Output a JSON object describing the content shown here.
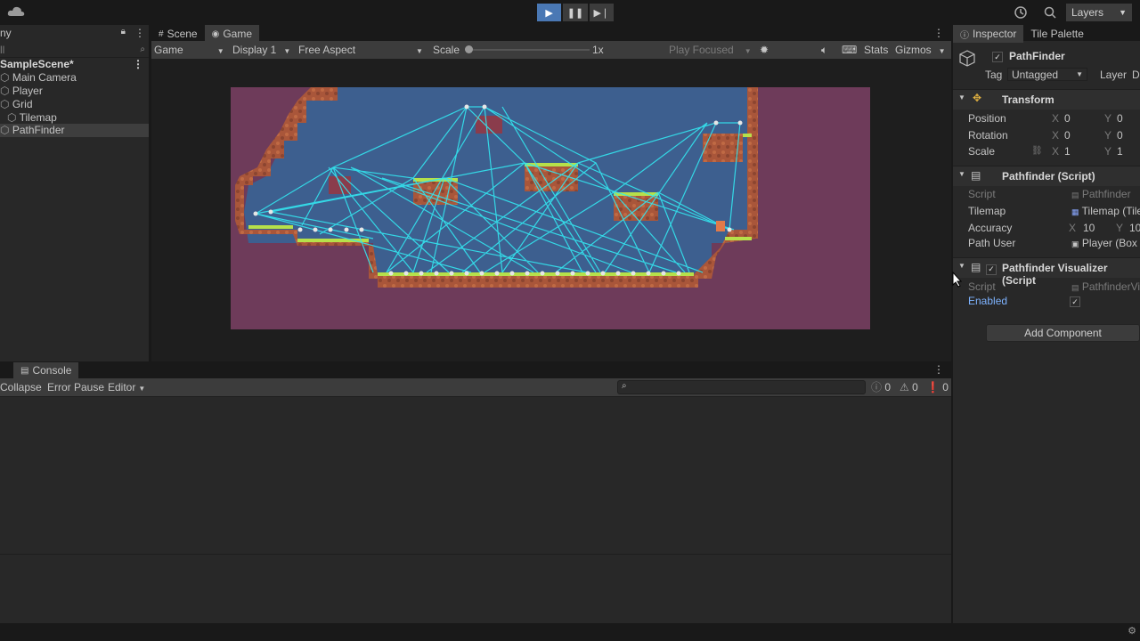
{
  "toolbar": {
    "layers_label": "Layers",
    "play": "▶",
    "pause": "❚❚",
    "step": "▶❘"
  },
  "hierarchy": {
    "tab_label": "ny",
    "search_placeholder": "ll",
    "items": [
      {
        "label": "SampleScene*"
      },
      {
        "label": "Main Camera"
      },
      {
        "label": "Player"
      },
      {
        "label": "Grid"
      },
      {
        "label": "Tilemap"
      },
      {
        "label": "PathFinder"
      }
    ]
  },
  "game_view": {
    "tabs": [
      {
        "label": "Scene"
      },
      {
        "label": "Game"
      }
    ],
    "toolbar": {
      "mode": "Game",
      "display": "Display 1",
      "aspect": "Free Aspect",
      "scale_label": "Scale",
      "scale_value": "1x",
      "play_focused": "Play Focused",
      "stats": "Stats",
      "gizmos": "Gizmos"
    }
  },
  "console": {
    "tab_label": "Console",
    "collapse": "Collapse",
    "error_pause": "Error Pause",
    "editor": "Editor",
    "counts": {
      "info": "0",
      "warn": "0",
      "error": "0"
    }
  },
  "inspector": {
    "tabs": [
      {
        "label": "Inspector"
      },
      {
        "label": "Tile Palette"
      }
    ],
    "object_name": "PathFinder",
    "tag_label": "Tag",
    "tag_value": "Untagged",
    "layer_label": "Layer",
    "layer_value": "D",
    "transform": {
      "title": "Transform",
      "position": {
        "label": "Position",
        "x": "0",
        "y": "0"
      },
      "rotation": {
        "label": "Rotation",
        "x": "0",
        "y": "0"
      },
      "scale": {
        "label": "Scale",
        "x": "1",
        "y": "1"
      }
    },
    "pathfinder": {
      "title": "Pathfinder (Script)",
      "script_label": "Script",
      "script_value": "Pathfinder",
      "tilemap_label": "Tilemap",
      "tilemap_value": "Tilemap (Tile",
      "accuracy_label": "Accuracy",
      "accuracy_x": "10",
      "accuracy_y": "10",
      "pathuser_label": "Path User",
      "pathuser_value": "Player (Box"
    },
    "visualizer": {
      "title": "Pathfinder Visualizer (Script",
      "script_label": "Script",
      "script_value": "PathfinderVi",
      "enabled_label": "Enabled"
    },
    "add_component": "Add Component"
  },
  "colors": {
    "accent": "#4a78b4",
    "graph_edge": "#33e6f0",
    "sky": "#3d5f8f",
    "bg_wall": "#6e3b5a"
  }
}
